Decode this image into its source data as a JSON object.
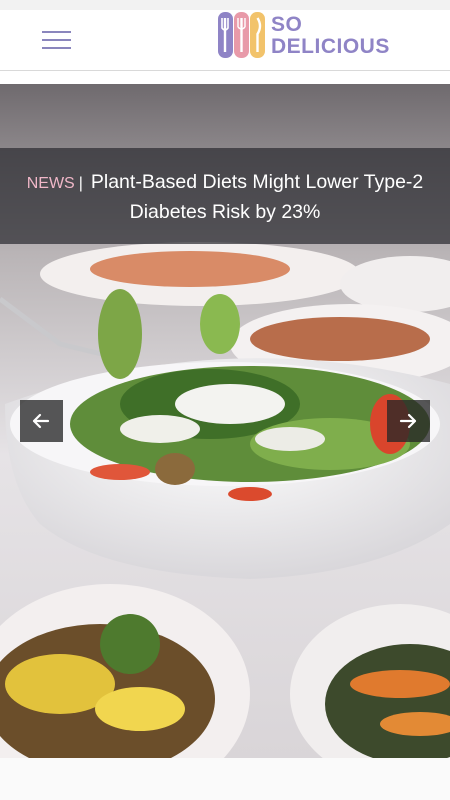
{
  "header": {
    "menu_icon": "hamburger-menu-icon",
    "logo": {
      "line1": "SO",
      "line2": "DELICIOUS",
      "color": "#8f84c6"
    }
  },
  "hero": {
    "category": "NEWS",
    "separator": "|",
    "title": "Plant-Based Diets Might Lower Type-2 Diabetes Risk by 23%",
    "prev_icon": "arrow-left-icon",
    "next_icon": "arrow-right-icon"
  },
  "colors": {
    "accent": "#8f84c6",
    "tag": "#f0b7c8",
    "band": "#2d2d32"
  }
}
